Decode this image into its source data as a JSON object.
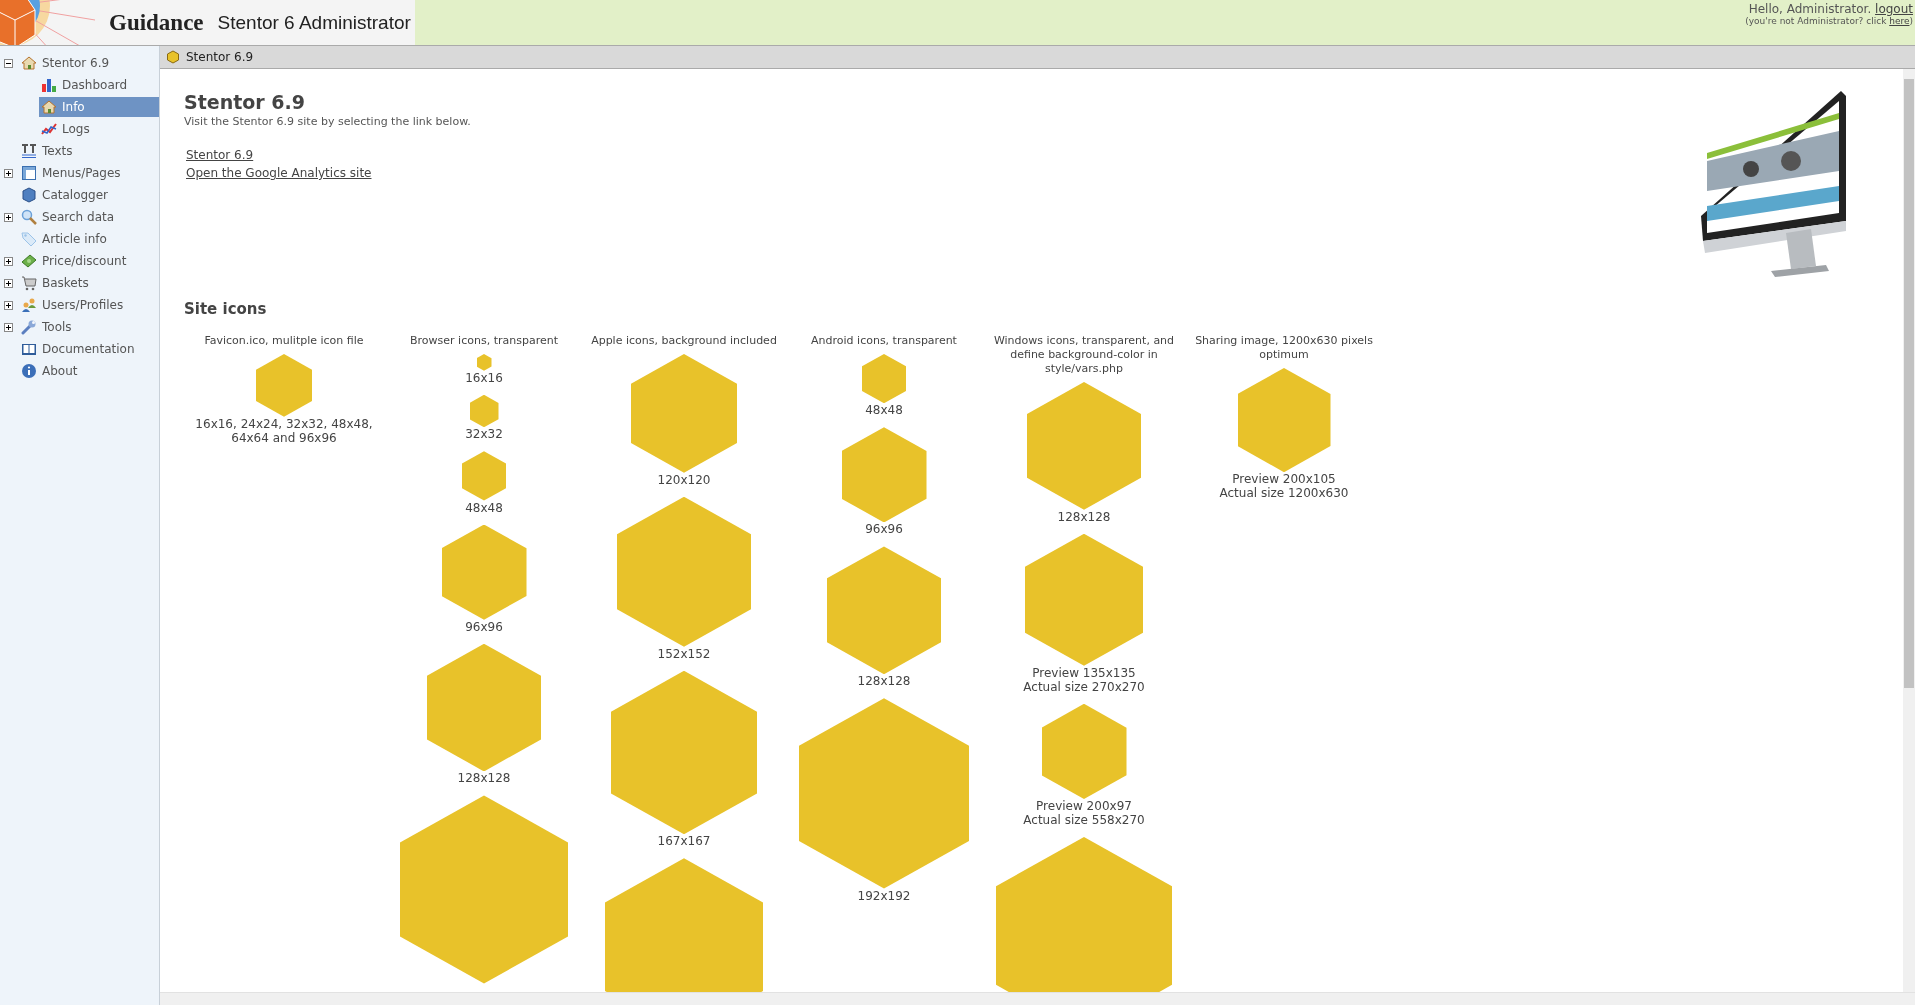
{
  "header": {
    "brand": "Guidance",
    "product": "Stentor 6 Administrator",
    "greeting": "Hello, Administrator.",
    "logout": "logout",
    "hint": "(you're not Administrator? click ",
    "hint_link": "here",
    "hint_end": ")"
  },
  "sidebar": {
    "items": [
      {
        "label": "Stentor 6.9",
        "expanded": true,
        "selected": false,
        "children": [
          {
            "label": "Dashboard",
            "selected": false
          },
          {
            "label": "Info",
            "selected": true
          },
          {
            "label": "Logs",
            "selected": false
          }
        ]
      },
      {
        "label": "Texts",
        "selected": false
      },
      {
        "label": "Menus/Pages",
        "expanded": false,
        "selected": false
      },
      {
        "label": "Catalogger",
        "selected": false
      },
      {
        "label": "Search data",
        "expanded": false,
        "selected": false
      },
      {
        "label": "Article info",
        "selected": false
      },
      {
        "label": "Price/discount",
        "expanded": false,
        "selected": false
      },
      {
        "label": "Baskets",
        "expanded": false,
        "selected": false
      },
      {
        "label": "Users/Profiles",
        "expanded": false,
        "selected": false
      },
      {
        "label": "Tools",
        "expanded": false,
        "selected": false
      },
      {
        "label": "Documentation",
        "selected": false
      },
      {
        "label": "About",
        "selected": false
      }
    ]
  },
  "breadcrumb": "Stentor 6.9",
  "content": {
    "title": "Stentor 6.9",
    "intro": "Visit the Stentor 6.9 site by selecting the link below.",
    "links": [
      "Stentor 6.9",
      "Open the Google Analytics site"
    ],
    "section_title": "Site icons",
    "columns": [
      {
        "heading": "Favicon.ico, mulitple icon file",
        "captions": [
          [
            "16x16, 24x24, 32x32, 48x48, 64x64 and 96x96"
          ]
        ]
      },
      {
        "heading": "Browser icons, transparent",
        "captions": [
          [
            "16x16"
          ],
          [
            "32x32"
          ],
          [
            "48x48"
          ],
          [
            "96x96"
          ],
          [
            "128x128"
          ]
        ]
      },
      {
        "heading": "Apple icons, background included",
        "captions": [
          [
            "120x120"
          ],
          [
            "152x152"
          ],
          [
            "167x167"
          ]
        ]
      },
      {
        "heading": "Android icons, transparent",
        "captions": [
          [
            "48x48"
          ],
          [
            "96x96"
          ],
          [
            "128x128"
          ],
          [
            "192x192"
          ]
        ]
      },
      {
        "heading": "Windows icons, transparent, and define background-color in style/vars.php",
        "captions": [
          [
            "128x128"
          ],
          [
            "Preview 135x135",
            "Actual size 270x270"
          ],
          [
            "Preview 200x97",
            "Actual size 558x270"
          ]
        ]
      },
      {
        "heading": "Sharing image, 1200x630 pixels optimum",
        "captions": [
          [
            "Preview 200x105",
            "Actual size 1200x630"
          ]
        ]
      }
    ]
  }
}
